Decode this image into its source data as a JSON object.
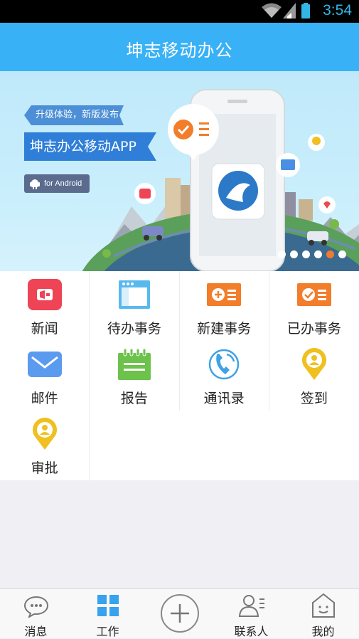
{
  "status_bar": {
    "time": "3:54"
  },
  "header": {
    "title": "坤志移动办公"
  },
  "banner": {
    "ribbon_small": "升级体验，新版发布",
    "ribbon_large": "坤志办公移动APP",
    "platform_badge": "for Android",
    "carousel_dots": 6,
    "carousel_active_index": 4
  },
  "grid": [
    {
      "label": "新闻",
      "icon": "megaphone-icon",
      "color": "#ee4455"
    },
    {
      "label": "待办事务",
      "icon": "browser-window-icon",
      "color": "#58b9ee"
    },
    {
      "label": "新建事务",
      "icon": "new-task-icon",
      "color": "#f27d2a"
    },
    {
      "label": "已办事务",
      "icon": "done-task-icon",
      "color": "#f27d2a"
    },
    {
      "label": "邮件",
      "icon": "envelope-icon",
      "color": "#5b9bef"
    },
    {
      "label": "报告",
      "icon": "notepad-icon",
      "color": "#6cc24a"
    },
    {
      "label": "通讯录",
      "icon": "phone-icon",
      "color": "#3fa2e6"
    },
    {
      "label": "签到",
      "icon": "location-pin-icon",
      "color": "#f0c020"
    },
    {
      "label": "审批",
      "icon": "location-pin-icon",
      "color": "#f0c020"
    }
  ],
  "tabbar": {
    "items": [
      {
        "label": "消息",
        "icon": "chat-bubble-icon"
      },
      {
        "label": "工作",
        "icon": "grid-icon",
        "active": true
      },
      {
        "label": "",
        "icon": "plus-circle-icon"
      },
      {
        "label": "联系人",
        "icon": "contacts-icon"
      },
      {
        "label": "我的",
        "icon": "profile-house-icon"
      }
    ]
  },
  "colors": {
    "accent": "#38b1f6",
    "active_tab": "#38a2ee"
  }
}
